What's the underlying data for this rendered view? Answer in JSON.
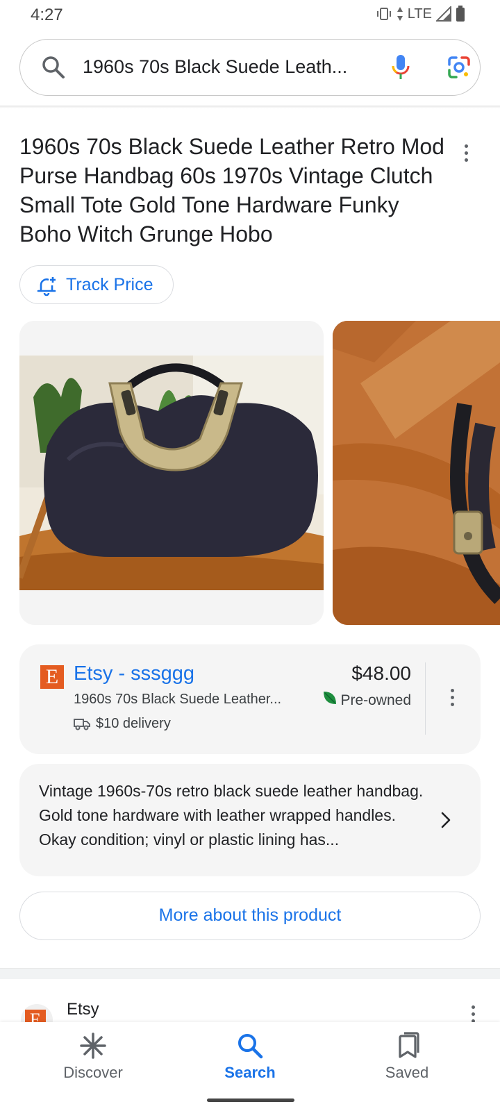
{
  "status_bar": {
    "time": "4:27",
    "network": "LTE",
    "icons": [
      "vibrate-icon",
      "data-arrows-icon",
      "signal-icon",
      "battery-icon"
    ]
  },
  "search": {
    "query": "1960s 70s Black Suede Leath...",
    "icons": [
      "search-icon",
      "mic-icon",
      "lens-icon"
    ]
  },
  "product": {
    "title": "1960s 70s Black Suede Leather Retro Mod Purse Handbag 60s 1970s Vintage Clutch Small Tote Gold Tone Hardware Funky Boho Witch Grunge Hobo",
    "track_price_label": "Track Price"
  },
  "offer": {
    "seller": "Etsy - sssggg",
    "seller_logo_letter": "E",
    "description": "1960s 70s Black Suede Leather...",
    "delivery": "$10 delivery",
    "price": "$48.00",
    "condition": "Pre-owned"
  },
  "details": {
    "text": "Vintage 1960s-70s retro black suede leather handbag. Gold tone hardware with leather wrapped handles. Okay condition; vinyl or plastic lining has..."
  },
  "more_button_label": "More about this product",
  "next_result": {
    "seller": "Etsy",
    "logo_letter": "E"
  },
  "bottom_nav": [
    {
      "label": "Discover",
      "icon": "asterisk-icon",
      "active": false
    },
    {
      "label": "Search",
      "icon": "search-icon",
      "active": true
    },
    {
      "label": "Saved",
      "icon": "bookmarks-icon",
      "active": false
    }
  ],
  "colors": {
    "accent": "#1a73e8",
    "etsy": "#e45c21",
    "card_bg": "#f5f5f5"
  }
}
